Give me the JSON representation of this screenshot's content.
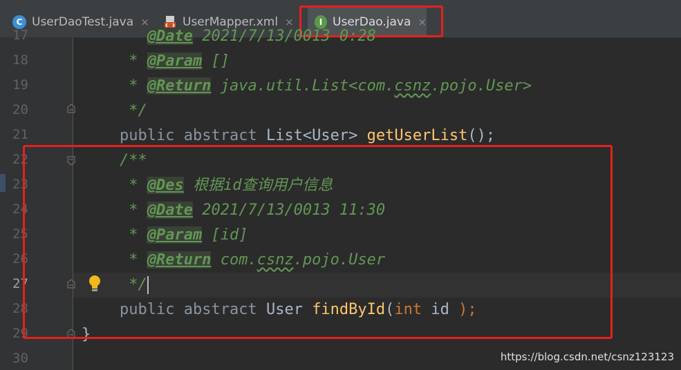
{
  "tabs": [
    {
      "label": "UserDaoTest.java",
      "icon": "C",
      "icon_color": "#3c8fd1"
    },
    {
      "label": "UserMapper.xml",
      "icon": "xml"
    },
    {
      "label": "UserDao.java",
      "icon": "I",
      "icon_color": "#5a9a4a"
    }
  ],
  "close_glyph": "×",
  "lines": {
    "l17": {
      "num": "17",
      "tag": "@Date",
      "text": " 2021/7/13/0013 0:28"
    },
    "l18": {
      "num": "18",
      "star": " * ",
      "tag": "@Param",
      "text": " []"
    },
    "l19": {
      "num": "19",
      "star": " * ",
      "tag": "@Return",
      "text_a": " java.util.List<com.",
      "wavy": "csnz",
      "text_b": ".pojo.User>"
    },
    "l20": {
      "num": "20",
      "text": " */"
    },
    "l21": {
      "num": "21",
      "kw1": "public",
      "kw2": "abstract",
      "type": "List<User>",
      "fn": "getUserList",
      "tail": "();"
    },
    "l22": {
      "num": "22",
      "text": "/**"
    },
    "l23": {
      "num": "23",
      "star": " * ",
      "tag": "@Des",
      "text": " 根据id查询用户信息"
    },
    "l24": {
      "num": "24",
      "star": " * ",
      "tag": "@Date",
      "text": " 2021/7/13/0013 11:30"
    },
    "l25": {
      "num": "25",
      "star": " * ",
      "tag": "@Param",
      "text": " [id]"
    },
    "l26": {
      "num": "26",
      "star": " * ",
      "tag": "@Return",
      "text_a": " com.",
      "wavy": "csnz",
      "text_b": ".pojo.User"
    },
    "l27": {
      "num": "27",
      "text": " */"
    },
    "l28": {
      "num": "28",
      "kw1": "public",
      "kw2": "abstract",
      "type": "User",
      "fn": "findById",
      "paren": "(",
      "kw3": "int",
      "param": " id ",
      "tail": ");"
    },
    "l29": {
      "num": "29",
      "text": "}"
    },
    "l30": {
      "num": "30"
    }
  },
  "watermark": "https://blog.csdn.net/csnz123123",
  "colors": {
    "highlight_box": "#e8201c",
    "doc_green": "#629755",
    "keyword": "#cc7832",
    "function": "#ffc66d"
  }
}
